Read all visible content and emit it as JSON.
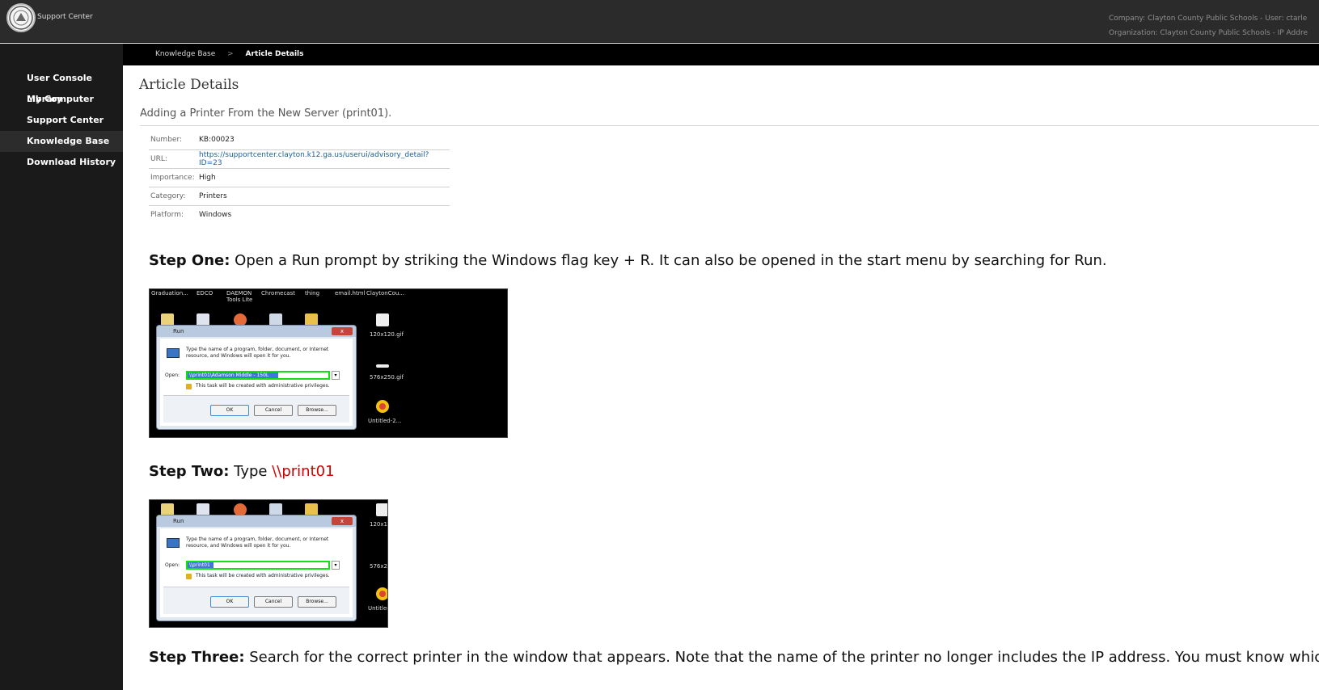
{
  "header": {
    "brand": "Support Center",
    "company_line": "Company: Clayton County Public Schools - User: ctarle",
    "org_line": "Organization: Clayton County Public Schools - IP Addre"
  },
  "sidebar": {
    "items": [
      {
        "label": "User Console Library",
        "active": false
      },
      {
        "label": "My Computer",
        "active": false
      },
      {
        "label": "Support Center",
        "active": false
      },
      {
        "label": "Knowledge Base",
        "active": true
      },
      {
        "label": "Download History",
        "active": false
      }
    ]
  },
  "breadcrumb": {
    "items": [
      "Knowledge Base",
      "Article Details"
    ],
    "separator": ">"
  },
  "main": {
    "page_title": "Article Details",
    "article_title": "Adding a Printer From the New Server (print01).",
    "meta": [
      {
        "key": "Number:",
        "value": "KB:00023",
        "link": false
      },
      {
        "key": "URL:",
        "value": "https://supportcenter.clayton.k12.ga.us/userui/advisory_detail?ID=23",
        "link": true
      },
      {
        "key": "Importance:",
        "value": "High",
        "link": false
      },
      {
        "key": "Category:",
        "value": "Printers",
        "link": false
      },
      {
        "key": "Platform:",
        "value": "Windows",
        "link": false
      }
    ],
    "steps": [
      {
        "heading": "Step One:",
        "text": " Open a Run prompt by striking the Windows flag key + R. It can also be opened in the start menu by searching for Run.",
        "highlight": ""
      },
      {
        "heading": "Step Two:",
        "text": " Type ",
        "highlight": "\\\\print01"
      },
      {
        "heading": "Step Three:",
        "text": " Search for the correct printer in the window that appears. Note that the name of the printer no longer includes the IP address. You must know which print",
        "highlight": ""
      }
    ],
    "screenshots": [
      {
        "desktop_labels": [
          "Graduation...",
          "EDCO",
          "DAEMON Tools Lite",
          "Chromecast",
          "thing",
          "email.html",
          "ClaytonCou...",
          "120x120.gif",
          "576x250.gif",
          "Untitled-2..."
        ],
        "dialog": {
          "title": "Run",
          "close": "x",
          "description": "Type the name of a program, folder, document, or Internet resource, and Windows will open it for you.",
          "open_label": "Open:",
          "open_value": "\\\\print01\\Adamson Middle - 150L",
          "admin_note": "This task will be created with administrative privileges.",
          "buttons": [
            "OK",
            "Cancel",
            "Browse..."
          ]
        }
      },
      {
        "desktop_labels": [
          "120x12",
          "576x25",
          "Untitled"
        ],
        "dialog": {
          "title": "Run",
          "close": "x",
          "description": "Type the name of a program, folder, document, or Internet resource, and Windows will open it for you.",
          "open_label": "Open:",
          "open_value": "\\\\print01",
          "admin_note": "This task will be created with administrative privileges.",
          "buttons": [
            "OK",
            "Cancel",
            "Browse..."
          ]
        }
      }
    ]
  },
  "colors": {
    "header_bg": "#2b2b2b",
    "sidebar_bg": "#1a1a1a",
    "link": "#1a5fa0",
    "highlight_red": "#d00000",
    "field_outline": "#13e013"
  }
}
